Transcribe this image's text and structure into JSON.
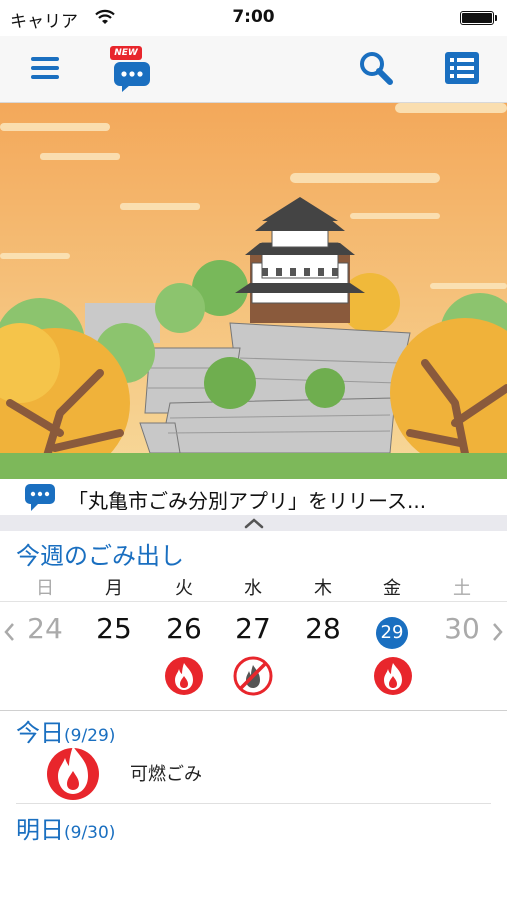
{
  "status_bar": {
    "carrier": "キャリア",
    "time": "7:00"
  },
  "nav": {
    "new_badge": "NEW"
  },
  "news": {
    "headline": "「丸亀市ごみ分別アプリ」をリリース..."
  },
  "week": {
    "title": "今週のごみ出し",
    "weekdays": [
      "日",
      "月",
      "火",
      "水",
      "木",
      "金",
      "土"
    ],
    "dates": [
      "24",
      "25",
      "26",
      "27",
      "28",
      "29",
      "30"
    ],
    "today_index": 5
  },
  "today": {
    "label": "今日",
    "date": "(9/29)",
    "item": "可燃ごみ"
  },
  "tomorrow": {
    "label": "明日",
    "date": "(9/30)"
  },
  "colors": {
    "accent": "#1a6fc0",
    "fire_red": "#e8262c"
  }
}
